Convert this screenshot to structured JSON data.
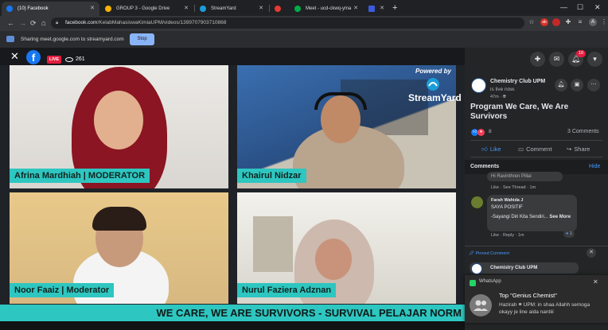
{
  "browser": {
    "tabs": [
      {
        "label": "(10) Facebook",
        "active": true,
        "favicon_color": "#1877f2"
      },
      {
        "label": "GROUP 3 - Google Drive",
        "active": false,
        "favicon_color": "#f4b400"
      },
      {
        "label": "StreamYard",
        "active": false,
        "favicon_color": "#1b9dd9"
      },
      {
        "label": "",
        "active": false,
        "favicon_color": "#e53935"
      },
      {
        "label": "Meet - ucd-ckwq-yma",
        "active": false,
        "favicon_color": "#00ac47"
      },
      {
        "label": "",
        "active": false,
        "favicon_color": "#3b5bdb"
      }
    ],
    "new_tab": "+",
    "url_host": "facebook.com",
    "url_path": "/KelabMahasiswaKimiaUPM/videos/1399707903710868",
    "back": "←",
    "forward": "→",
    "reload": "⟳",
    "home": "⌂",
    "notif_badge": "10",
    "window_min": "—",
    "window_max": "☐",
    "window_close": "✕"
  },
  "sharing_bar": {
    "text": "Sharing meet.google.com to streamyard.com",
    "stop_label": "Stop"
  },
  "video": {
    "live_label": "LIVE",
    "viewer_count": "261",
    "powered_by": "Powered by",
    "brand": "StreamYard",
    "participants": [
      {
        "name": "Afrina Mardhiah | MODERATOR"
      },
      {
        "name": "Khairul Nidzar"
      },
      {
        "name": "Noor Faaiz | Moderator"
      },
      {
        "name": "Nurul Faziera Adznan"
      }
    ],
    "ticker": "WE CARE, WE ARE SURVIVORS - SURVIVAL PELAJAR NORM"
  },
  "sidebar": {
    "header_badge": "10",
    "page_name": "Chemistry Club UPM",
    "live_now": "is live now.",
    "time_ago": "47m · ",
    "post_title": "Program We Care, We Are Survivors",
    "reaction_count": "8",
    "comments_count": "3 Comments",
    "actions": {
      "like": "Like",
      "comment": "Comment",
      "share": "Share"
    },
    "comments_heading": "Comments",
    "hide_label": "Hide",
    "comment_1": {
      "text": "Hi Ravinthren Pillai",
      "meta": "Like · See Thread · 1m"
    },
    "comment_2": {
      "author": "Farah Wahida J",
      "line1": "SAYA POSITIF",
      "line2": "-Sayangi Diri Kita Sendiri...",
      "see_more": "See More",
      "meta": "Like · Reply · 1m",
      "likes": "1"
    },
    "pinned_label": "Pinned Comment",
    "pinned_author": "Chemistry Club UPM"
  },
  "toast": {
    "app": "WhatsApp",
    "title": "Top \"Genius Chemist\"",
    "message": "Hazirah 🕾 UPM: in shaa Allahh semoga okayy je line aida nantiii",
    "close": "✕"
  },
  "colors": {
    "facebook_blue": "#1877f2",
    "name_tag": "#2ec6c0",
    "live_red": "#e41e3f"
  }
}
